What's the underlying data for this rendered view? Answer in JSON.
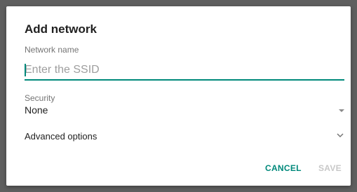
{
  "dialog": {
    "title": "Add network",
    "network_name_label": "Network name",
    "ssid_placeholder": "Enter the SSID",
    "ssid_value": "",
    "security_label": "Security",
    "security_value": "None",
    "advanced_label": "Advanced options",
    "cancel_label": "CANCEL",
    "save_label": "SAVE"
  },
  "colors": {
    "accent": "#00897b",
    "disabled": "#c8c8c8",
    "backdrop": "#5f5f5f"
  },
  "icons": {
    "security_dropdown": "dropdown-arrow-icon",
    "advanced_expand": "chevron-down-icon"
  }
}
